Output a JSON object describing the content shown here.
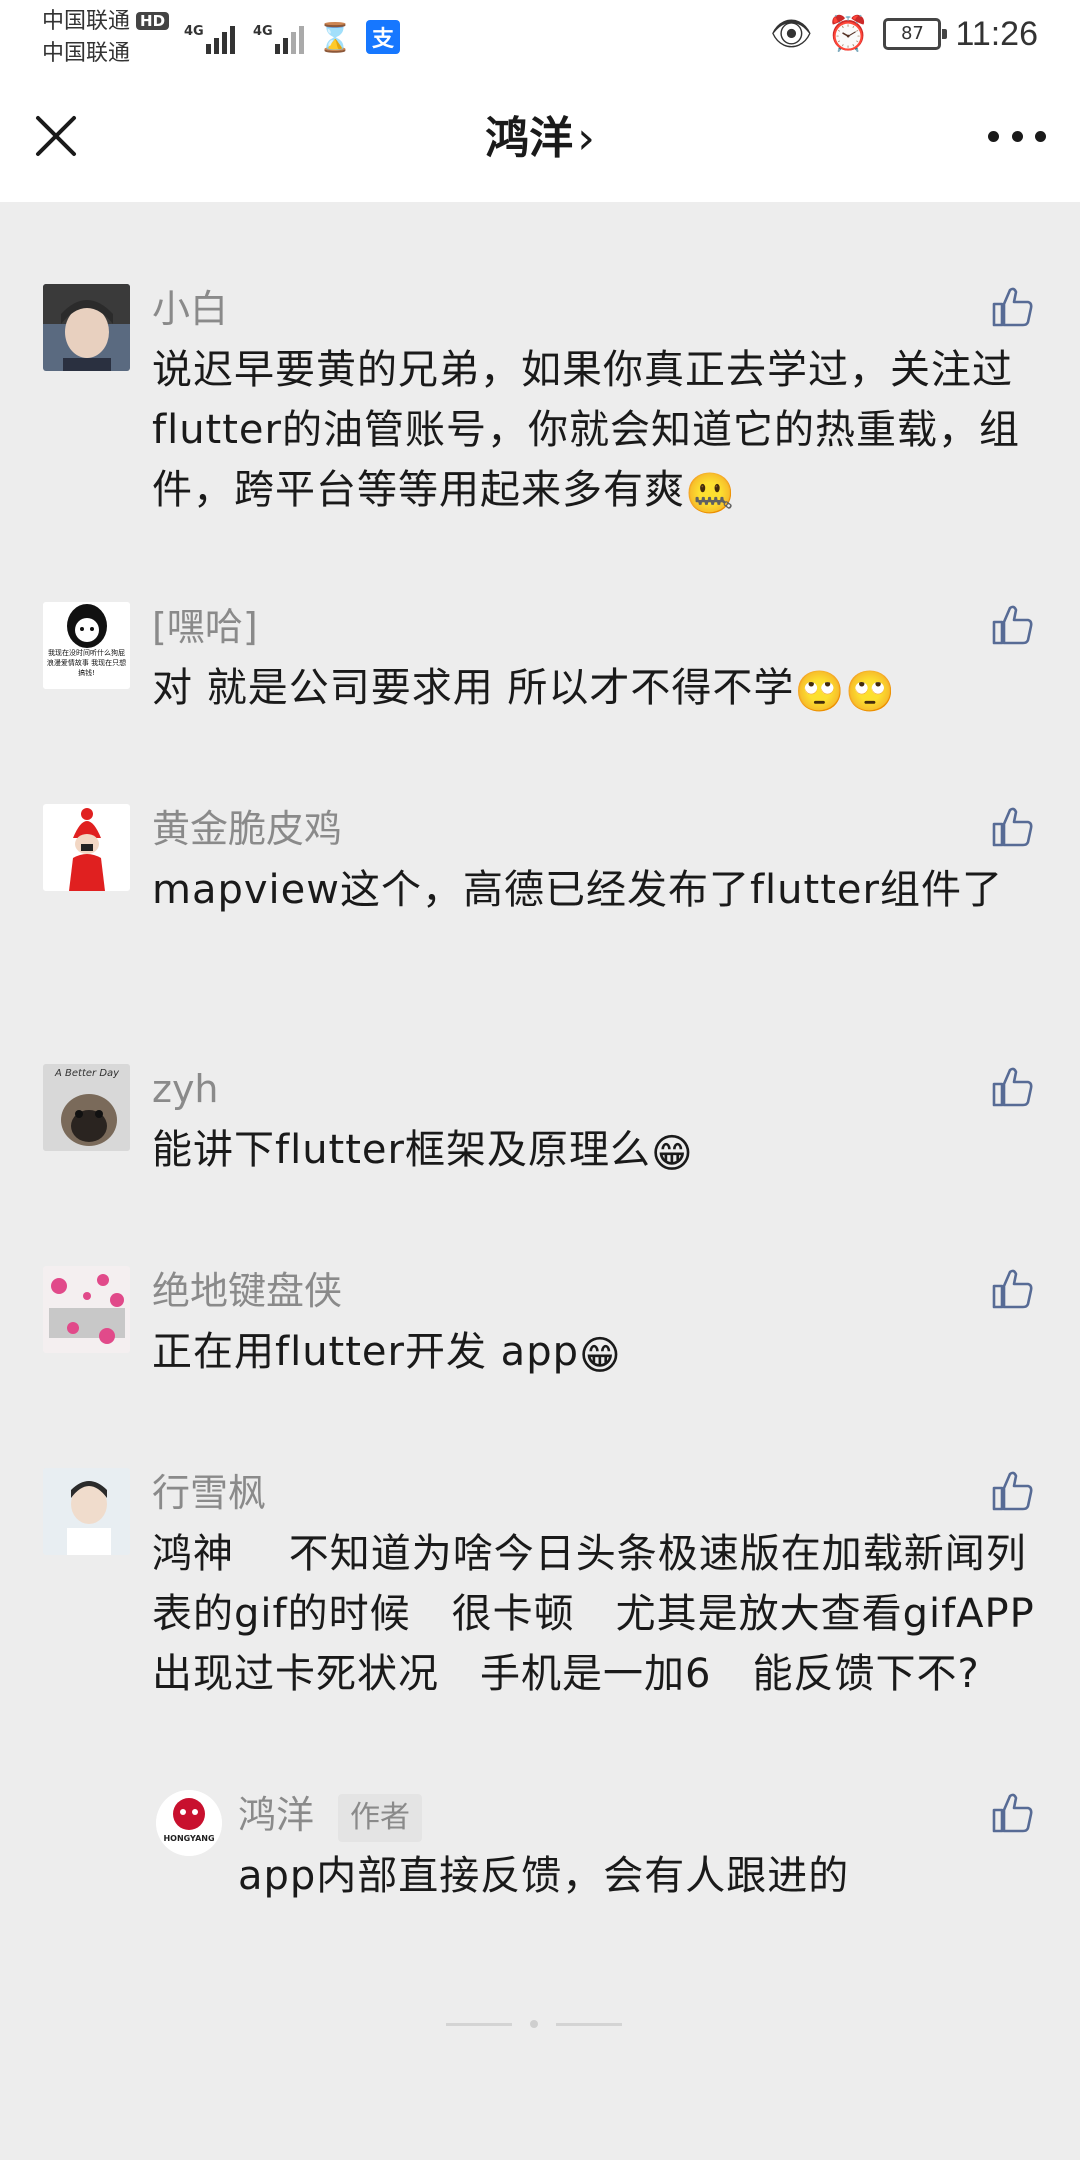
{
  "status_bar": {
    "carrier_1": "中国联通",
    "carrier_2": "中国联通",
    "hd_label": "HD",
    "net_1": "4G",
    "net_2": "4G",
    "alipay_glyph": "支",
    "battery": "87",
    "time": "11:26"
  },
  "nav": {
    "title": "鸿洋",
    "chevron": "›",
    "close_icon": "close-icon",
    "more_icon": "more-icon"
  },
  "comments": [
    {
      "name": "小白",
      "text": "说迟早要黄的兄弟，如果你真正去学过，关注过flutter的油管账号，你就会知道它的热重载，组件，跨平台等等用起来多有爽",
      "emoji": "🤐"
    },
    {
      "name": "[嘿哈]",
      "text": "对 就是公司要求用 所以才不得不学",
      "emoji": "🙄🙄",
      "avatar_caption": "我现在没时间听什么狗屁浪漫爱情故事 我现在只想搞钱!"
    },
    {
      "name": "黄金脆皮鸡",
      "text": "mapview这个，高德已经发布了flutter组件了",
      "emoji": ""
    },
    {
      "name": "zyh",
      "text": "能讲下flutter框架及原理么",
      "emoji": "😁",
      "avatar_caption": "A Better Day"
    },
    {
      "name": "绝地键盘侠",
      "text": "正在用flutter开发 app",
      "emoji": "😁"
    },
    {
      "name": "行雪枫",
      "text": "鸿神　 不知道为啥今日头条极速版在加载新闻列表的gif的时候　很卡顿　尤其是放大查看gifAPP出现过卡死状况　手机是一加6　能反馈下不?",
      "emoji": ""
    }
  ],
  "reply": {
    "name": "鸿洋",
    "badge": "作者",
    "text": "app内部直接反馈，会有人跟进的",
    "avatar_caption": "HONGYANG"
  }
}
